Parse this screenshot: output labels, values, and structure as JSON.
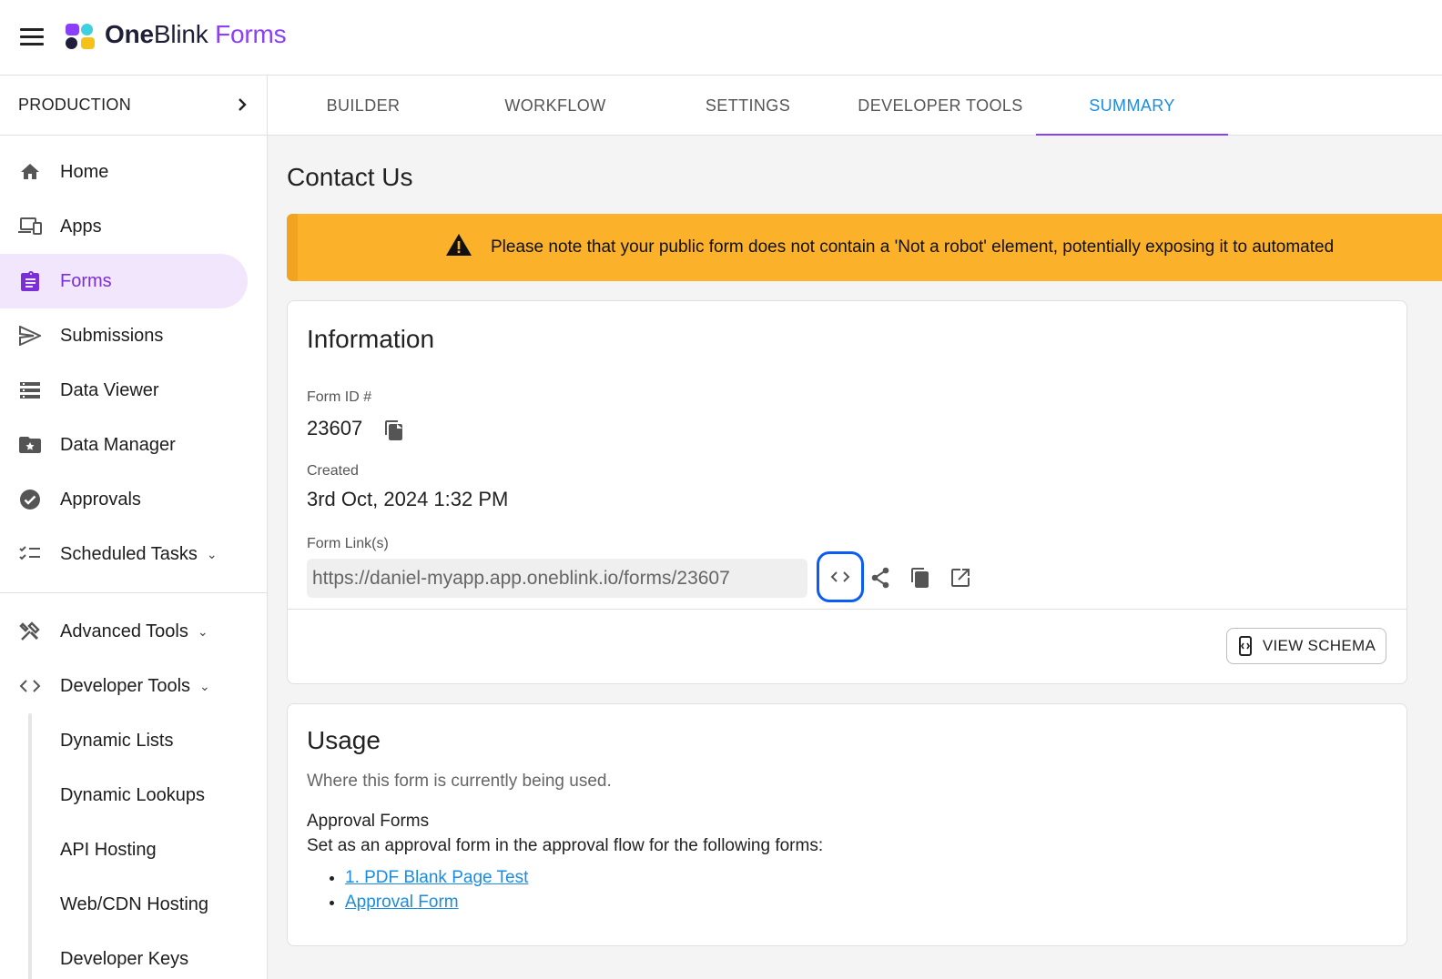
{
  "app": {
    "brand_one": "One",
    "brand_blink": "Blink",
    "brand_forms": " Forms",
    "accent": "#8a3ffc"
  },
  "sidebar": {
    "environment": "PRODUCTION",
    "items": [
      {
        "label": "Home",
        "icon": "home-icon"
      },
      {
        "label": "Apps",
        "icon": "devices-icon"
      },
      {
        "label": "Forms",
        "icon": "clipboard-icon",
        "active": true
      },
      {
        "label": "Submissions",
        "icon": "send-icon"
      },
      {
        "label": "Data Viewer",
        "icon": "list-icon"
      },
      {
        "label": "Data Manager",
        "icon": "folder-star-icon"
      },
      {
        "label": "Approvals",
        "icon": "check-circle-icon"
      },
      {
        "label": "Scheduled Tasks",
        "icon": "checklist-icon"
      }
    ],
    "tools": [
      {
        "label": "Advanced Tools",
        "icon": "tools-icon"
      },
      {
        "label": "Developer Tools",
        "icon": "code-icon"
      }
    ],
    "developer_subitems": [
      {
        "label": "Dynamic Lists"
      },
      {
        "label": "Dynamic Lookups"
      },
      {
        "label": "API Hosting"
      },
      {
        "label": "Web/CDN Hosting"
      },
      {
        "label": "Developer Keys"
      }
    ]
  },
  "tabs": [
    {
      "label": "BUILDER"
    },
    {
      "label": "WORKFLOW"
    },
    {
      "label": "SETTINGS"
    },
    {
      "label": "DEVELOPER TOOLS"
    },
    {
      "label": "SUMMARY",
      "active": true
    }
  ],
  "main": {
    "title": "Contact Us",
    "warning": "Please note that your public form does not contain a 'Not a robot' element, potentially exposing it to automated",
    "information": {
      "heading": "Information",
      "form_id_label": "Form ID #",
      "form_id": "23607",
      "created_label": "Created",
      "created": "3rd Oct, 2024 1:32 PM",
      "links_label": "Form Link(s)",
      "form_link": "https://daniel-myapp.app.oneblink.io/forms/23607",
      "view_schema": "VIEW SCHEMA"
    },
    "usage": {
      "heading": "Usage",
      "description": "Where this form is currently being used.",
      "subheading": "Approval Forms",
      "text": "Set as an approval form in the approval flow for the following forms:",
      "forms": [
        "1. PDF Blank Page Test",
        "Approval Form"
      ]
    }
  }
}
